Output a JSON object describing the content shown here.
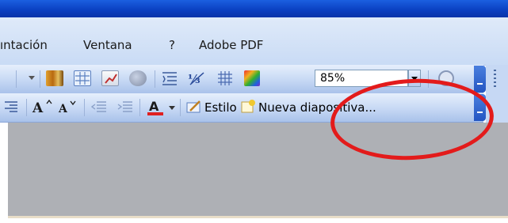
{
  "menubar": {
    "items": [
      {
        "label": "ıntación"
      },
      {
        "label": "Ventana"
      },
      {
        "label": "?"
      },
      {
        "label": "Adobe PDF"
      }
    ]
  },
  "toolbar_standard": {
    "zoom_value": "85%"
  },
  "toolbar_format": {
    "style_label": "Estilo",
    "new_slide_label": "Nueva diapositiva..."
  },
  "colors": {
    "annotation_ellipse": "#e31b1b",
    "toolbar_gradient_top": "#e6effc",
    "toolbar_gradient_bottom": "#a9c2ea",
    "workspace": "#aeb0b5"
  }
}
